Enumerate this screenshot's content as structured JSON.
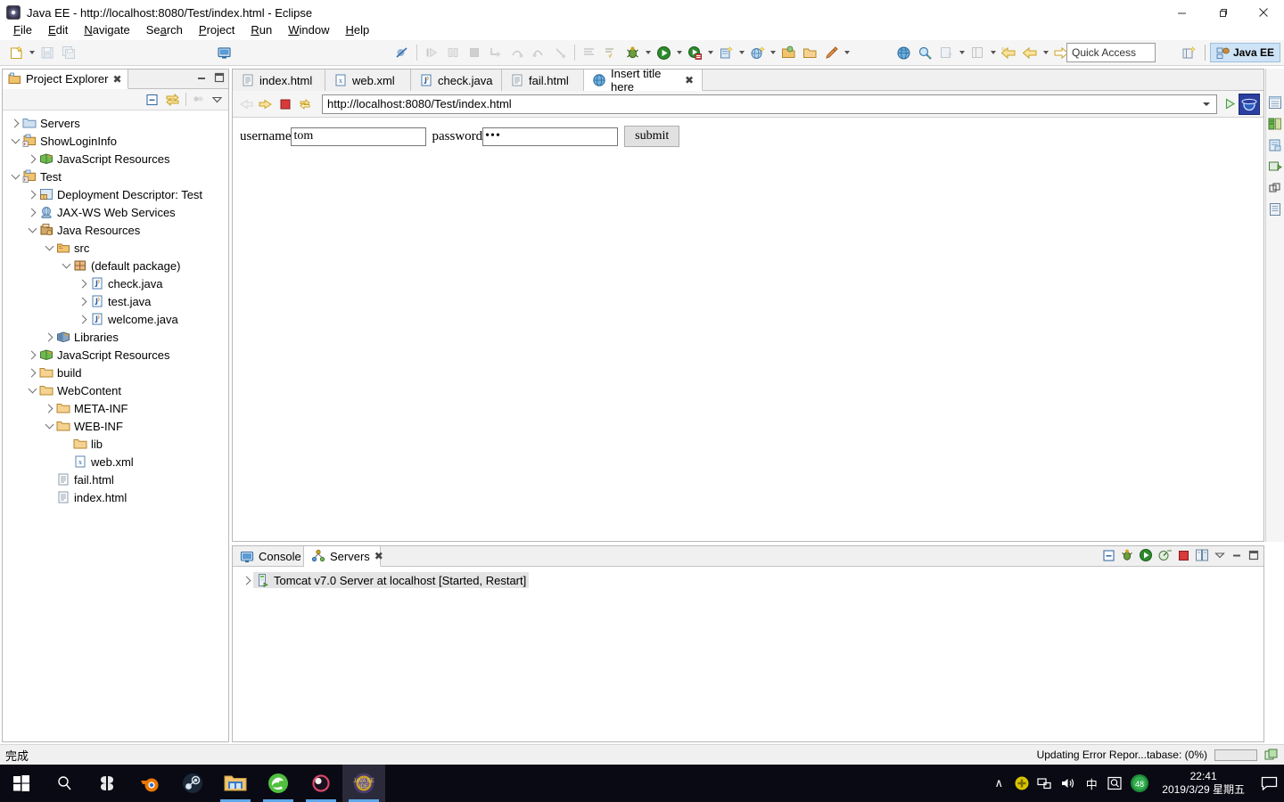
{
  "window": {
    "title": "Java EE - http://localhost:8080/Test/index.html - Eclipse",
    "minimize_label": "—",
    "maximize_label": "❐",
    "close_label": "✕"
  },
  "menubar": {
    "items": [
      {
        "label": "File",
        "mnemonic": "F"
      },
      {
        "label": "Edit",
        "mnemonic": "E"
      },
      {
        "label": "Navigate",
        "mnemonic": "N"
      },
      {
        "label": "Search",
        "mnemonic": "a"
      },
      {
        "label": "Project",
        "mnemonic": "P"
      },
      {
        "label": "Run",
        "mnemonic": "R"
      },
      {
        "label": "Window",
        "mnemonic": "W"
      },
      {
        "label": "Help",
        "mnemonic": "H"
      }
    ]
  },
  "toolbar": {
    "quick_access_placeholder": "Quick Access",
    "perspective_label": "Java EE",
    "icons": [
      "new-wizard-icon",
      "save-icon",
      "save-all-icon",
      "new-server-icon",
      "toggle-breakpoint-icon",
      "resume-icon",
      "suspend-icon",
      "terminate-icon",
      "step-into-icon",
      "step-over-icon",
      "step-return-icon",
      "drop-to-frame-icon",
      "skip-breakpoints-icon",
      "external-tools-icon",
      "debug-icon",
      "run-icon",
      "run-on-server-icon",
      "new-java-project-icon",
      "new-class-icon",
      "open-type-icon",
      "open-task-icon",
      "new-annotation-icon",
      "web-browser-icon",
      "search-icon",
      "open-perspective-icon",
      "last-edit-location-icon",
      "back-icon",
      "forward-icon"
    ]
  },
  "project_explorer": {
    "tab_label": "Project Explorer",
    "tab_icon": "project-explorer-icon",
    "close_glyph": "✖",
    "view_buttons": [
      "collapse-all-icon",
      "link-with-editor-icon",
      "view-menu-icon",
      "view-menu-arrow-icon"
    ],
    "tree": [
      {
        "label": "Servers",
        "depth": 0,
        "twisty": "right",
        "icon": "folder-servers-icon"
      },
      {
        "label": "ShowLoginInfo",
        "depth": 0,
        "twisty": "down",
        "icon": "dynamic-web-project-icon"
      },
      {
        "label": "JavaScript Resources",
        "depth": 1,
        "twisty": "right",
        "icon": "js-library-icon"
      },
      {
        "label": "Test",
        "depth": 0,
        "twisty": "down",
        "icon": "dynamic-web-project-icon"
      },
      {
        "label": "Deployment Descriptor: Test",
        "depth": 1,
        "twisty": "right",
        "icon": "deployment-descriptor-icon"
      },
      {
        "label": "JAX-WS Web Services",
        "depth": 1,
        "twisty": "right",
        "icon": "jaxws-icon"
      },
      {
        "label": "Java Resources",
        "depth": 1,
        "twisty": "down",
        "icon": "java-resources-icon"
      },
      {
        "label": "src",
        "depth": 2,
        "twisty": "down",
        "icon": "source-folder-icon"
      },
      {
        "label": "(default package)",
        "depth": 3,
        "twisty": "down",
        "icon": "package-icon"
      },
      {
        "label": "check.java",
        "depth": 4,
        "twisty": "right",
        "icon": "java-file-icon"
      },
      {
        "label": "test.java",
        "depth": 4,
        "twisty": "right",
        "icon": "java-file-icon"
      },
      {
        "label": "welcome.java",
        "depth": 4,
        "twisty": "right",
        "icon": "java-file-icon"
      },
      {
        "label": "Libraries",
        "depth": 2,
        "twisty": "right",
        "icon": "library-icon"
      },
      {
        "label": "JavaScript Resources",
        "depth": 1,
        "twisty": "right",
        "icon": "js-library-icon"
      },
      {
        "label": "build",
        "depth": 1,
        "twisty": "right",
        "icon": "folder-icon"
      },
      {
        "label": "WebContent",
        "depth": 1,
        "twisty": "down",
        "icon": "folder-icon"
      },
      {
        "label": "META-INF",
        "depth": 2,
        "twisty": "right",
        "icon": "folder-icon"
      },
      {
        "label": "WEB-INF",
        "depth": 2,
        "twisty": "down",
        "icon": "folder-icon"
      },
      {
        "label": "lib",
        "depth": 3,
        "twisty": "none",
        "icon": "folder-icon"
      },
      {
        "label": "web.xml",
        "depth": 3,
        "twisty": "none",
        "icon": "xml-file-icon"
      },
      {
        "label": "fail.html",
        "depth": 2,
        "twisty": "none",
        "icon": "html-file-icon"
      },
      {
        "label": "index.html",
        "depth": 2,
        "twisty": "none",
        "icon": "html-file-icon"
      }
    ]
  },
  "editor": {
    "tabs": [
      {
        "label": "index.html",
        "icon": "html-file-icon",
        "active": false,
        "closable": false
      },
      {
        "label": "web.xml",
        "icon": "xml-file-icon",
        "active": false,
        "closable": false
      },
      {
        "label": "check.java",
        "icon": "java-file-icon",
        "active": false,
        "closable": false
      },
      {
        "label": "fail.html",
        "icon": "html-file-icon",
        "active": false,
        "closable": false
      },
      {
        "label": "Insert title here",
        "icon": "web-browser-icon",
        "active": true,
        "closable": true
      }
    ],
    "close_glyph": "✖",
    "browser": {
      "back_icon": "back-arrow-icon",
      "forward_icon": "forward-arrow-icon",
      "stop_icon": "stop-icon",
      "refresh_icon": "refresh-icon",
      "url": "http://localhost:8080/Test/index.html",
      "go_icon": "go-icon",
      "ie_icon": "internet-explorer-icon"
    },
    "page": {
      "username_label": "username",
      "username_value": "tom",
      "password_label": "password",
      "password_value": "•••",
      "submit_label": "submit"
    }
  },
  "fastview": {
    "icons": [
      "outline-view-icon",
      "palette-view-icon",
      "snippets-view-icon",
      "properties-view-icon",
      "markers-view-icon",
      "servers-view-icon"
    ]
  },
  "console_panel": {
    "tabs": [
      {
        "label": "Console",
        "icon": "console-icon",
        "active": false,
        "closable": false
      },
      {
        "label": "Servers",
        "icon": "servers-icon",
        "active": true,
        "closable": true
      }
    ],
    "close_glyph": "✖",
    "buttons": [
      "collapse-all-icon",
      "debug-server-icon",
      "start-server-icon",
      "profile-server-icon",
      "stop-server-icon",
      "publish-icon",
      "view-menu-arrow-icon",
      "minimize-icon",
      "maximize-icon"
    ],
    "rows": [
      {
        "label": "Tomcat v7.0 Server at localhost  [Started, Restart]",
        "icon": "server-icon",
        "twisty": "right",
        "selected": true
      }
    ]
  },
  "statusbar": {
    "left_text": "完成",
    "progress_text": "Updating Error Repor...tabase: (0%)",
    "progress_percent": 0,
    "progress_icon": "progress-view-icon"
  },
  "taskbar": {
    "items": [
      {
        "name": "start-button",
        "icon": "windows-logo-icon",
        "running": false,
        "active": false
      },
      {
        "name": "search-button",
        "icon": "search-icon",
        "running": false,
        "active": false
      },
      {
        "name": "task-view-button",
        "icon": "task-view-icon",
        "running": false,
        "active": false
      },
      {
        "name": "blender-app",
        "icon": "blender-icon",
        "running": false,
        "active": false
      },
      {
        "name": "steam-app",
        "icon": "steam-icon",
        "running": false,
        "active": false
      },
      {
        "name": "file-explorer-app",
        "icon": "file-explorer-icon",
        "running": true,
        "active": false
      },
      {
        "name": "edge-app",
        "icon": "edge-icon",
        "running": true,
        "active": false
      },
      {
        "name": "obs-app",
        "icon": "obs-icon",
        "running": true,
        "active": false
      },
      {
        "name": "eclipse-app",
        "icon": "eclipse-icon",
        "running": true,
        "active": true
      }
    ],
    "tray": {
      "overflow_glyph": "∧",
      "ime_label": "中",
      "search_label": "Q",
      "badge_label": "48",
      "time": "22:41",
      "date": "2019/3/29 星期五",
      "notification_icon": "notification-icon"
    }
  },
  "colors": {
    "accent_blue": "#3a6ea5",
    "folder_yellow": "#f0c36d",
    "java_blue": "#4a7ebb",
    "server_green": "#49a942",
    "taskbar_bg": "#0a0a14"
  }
}
